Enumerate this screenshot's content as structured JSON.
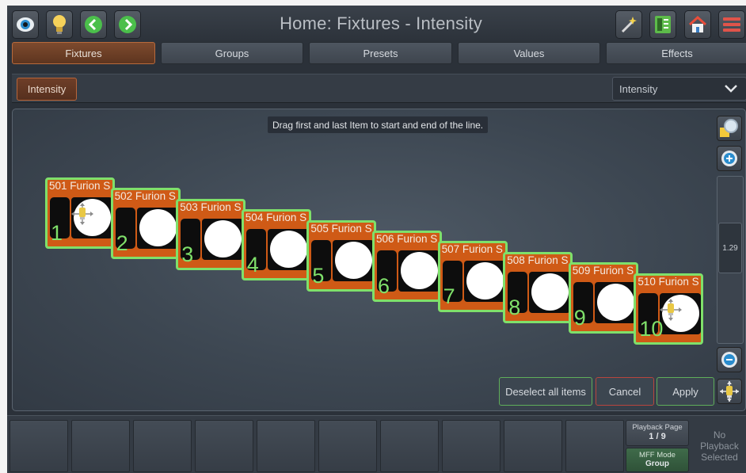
{
  "header": {
    "title": "Home: Fixtures - Intensity"
  },
  "tabs": [
    {
      "label": "Fixtures",
      "active": true
    },
    {
      "label": "Groups",
      "active": false
    },
    {
      "label": "Presets",
      "active": false
    },
    {
      "label": "Values",
      "active": false
    },
    {
      "label": "Effects",
      "active": false
    }
  ],
  "filter": {
    "chip_label": "Intensity",
    "attribute_select": "Intensity"
  },
  "canvas": {
    "hint": "Drag first and last Item to start and end of the line.",
    "zoom_value": "1.29"
  },
  "fixtures": [
    {
      "label": "501 Furion S",
      "number": "1"
    },
    {
      "label": "502 Furion S",
      "number": "2"
    },
    {
      "label": "503 Furion S",
      "number": "3"
    },
    {
      "label": "504 Furion S",
      "number": "4"
    },
    {
      "label": "505 Furion S",
      "number": "5"
    },
    {
      "label": "506 Furion S",
      "number": "6"
    },
    {
      "label": "507 Furion S",
      "number": "7"
    },
    {
      "label": "508 Furion S",
      "number": "8"
    },
    {
      "label": "509 Furion S",
      "number": "9"
    },
    {
      "label": "510 Furion S",
      "number": "10"
    }
  ],
  "actions": {
    "deselect": "Deselect all items",
    "cancel": "Cancel",
    "apply": "Apply"
  },
  "playback": {
    "page_label": "Playback Page",
    "page_value": "1 / 9",
    "mff_label": "MFF Mode",
    "mff_value": "Group",
    "no_playback": "No Playback Selected"
  },
  "colors": {
    "accent": "#cf5a16",
    "selection": "#7fe06a",
    "apply": "#5fae5a",
    "cancel": "#b8453e"
  },
  "icons": [
    "eye-icon",
    "bulb-icon",
    "back-icon",
    "forward-icon",
    "magic-wand-icon",
    "list-icon",
    "home-icon",
    "menu-icon"
  ]
}
